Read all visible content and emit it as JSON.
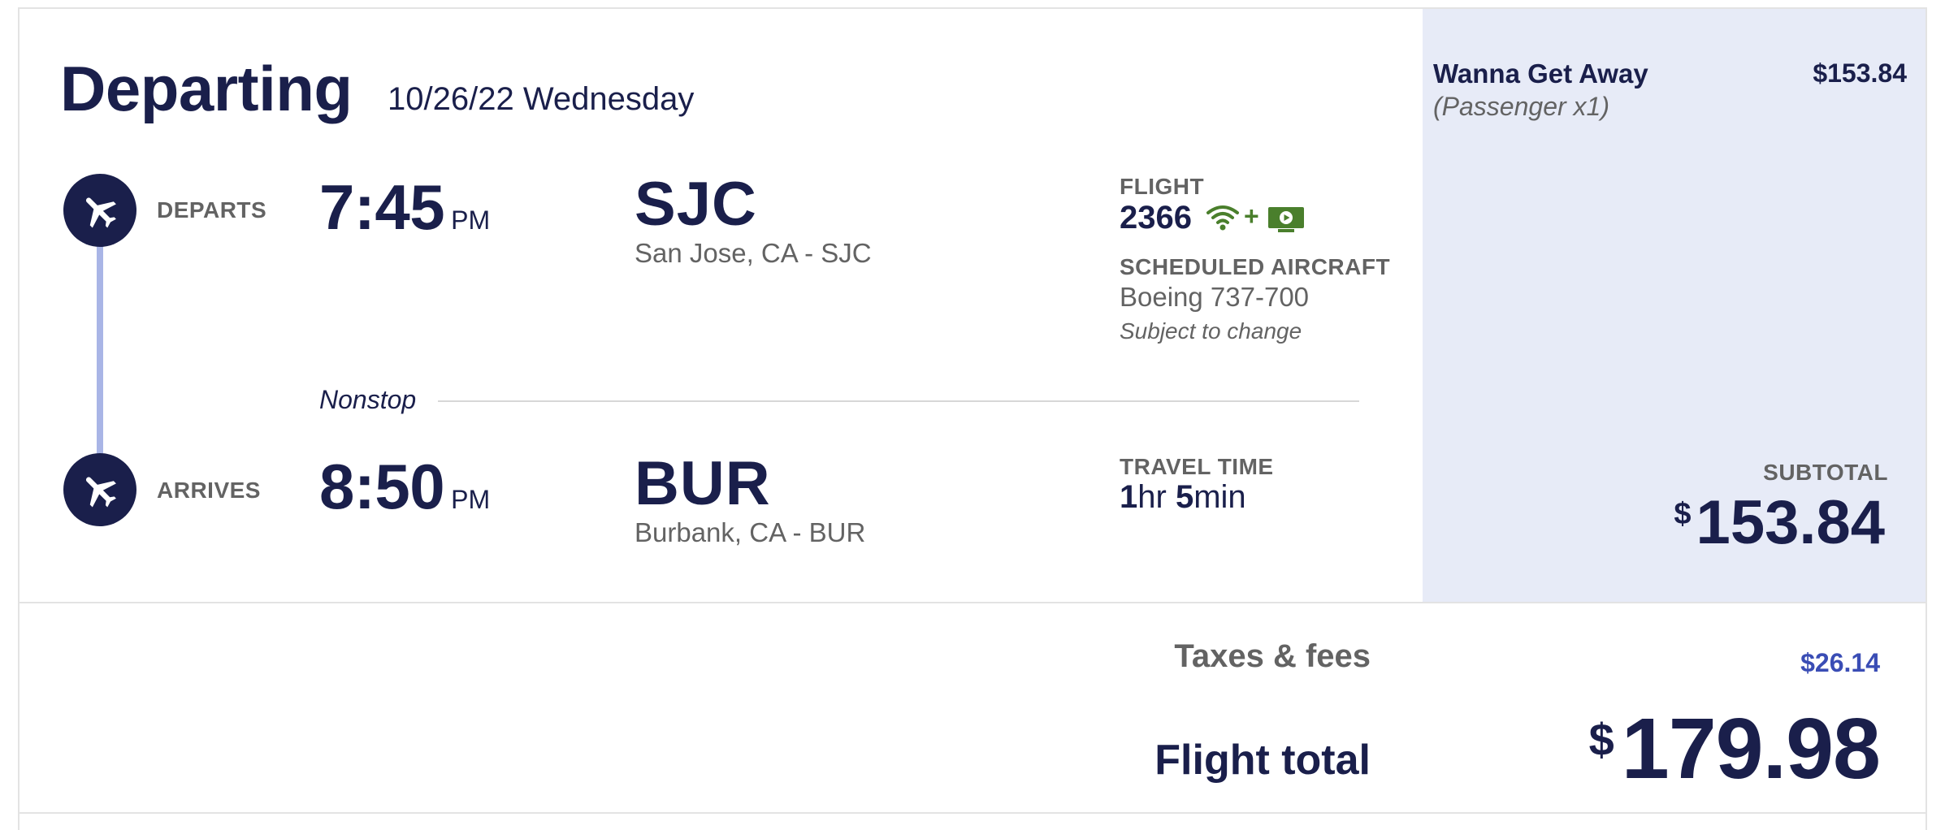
{
  "header": {
    "title": "Departing",
    "date": "10/26/22 Wednesday"
  },
  "departs": {
    "label": "DEPARTS",
    "time": "7:45",
    "ampm": "PM",
    "airport_code": "SJC",
    "city": "San Jose, CA - SJC"
  },
  "arrives": {
    "label": "ARRIVES",
    "time": "8:50",
    "ampm": "PM",
    "airport_code": "BUR",
    "city": "Burbank, CA - BUR"
  },
  "route": {
    "stops": "Nonstop"
  },
  "flight": {
    "label": "FLIGHT",
    "number": "2366",
    "plus": "+",
    "amenity_icons": [
      "wifi-icon",
      "tv-icon"
    ],
    "aircraft_label": "SCHEDULED AIRCRAFT",
    "aircraft": "Boeing 737-700",
    "aircraft_note": "Subject to change"
  },
  "travel_time": {
    "label": "TRAVEL TIME",
    "hours": "1",
    "hours_unit": "hr",
    "minutes": "5",
    "minutes_unit": "min"
  },
  "fare": {
    "name": "Wanna Get Away",
    "passengers": "(Passenger x1)",
    "price": "$153.84",
    "subtotal_label": "SUBTOTAL",
    "subtotal_currency": "$",
    "subtotal_amount": "153.84"
  },
  "totals": {
    "taxes_label": "Taxes & fees",
    "taxes_value": "$26.14",
    "total_label": "Flight total",
    "total_currency": "$",
    "total_amount": "179.98"
  },
  "colors": {
    "navy": "#1a1f4b",
    "fare_panel_bg": "#e7ebf7",
    "timeline": "#a9b5e6",
    "amenity_green": "#4a7f2c",
    "taxes_blue": "#3a4db5"
  }
}
